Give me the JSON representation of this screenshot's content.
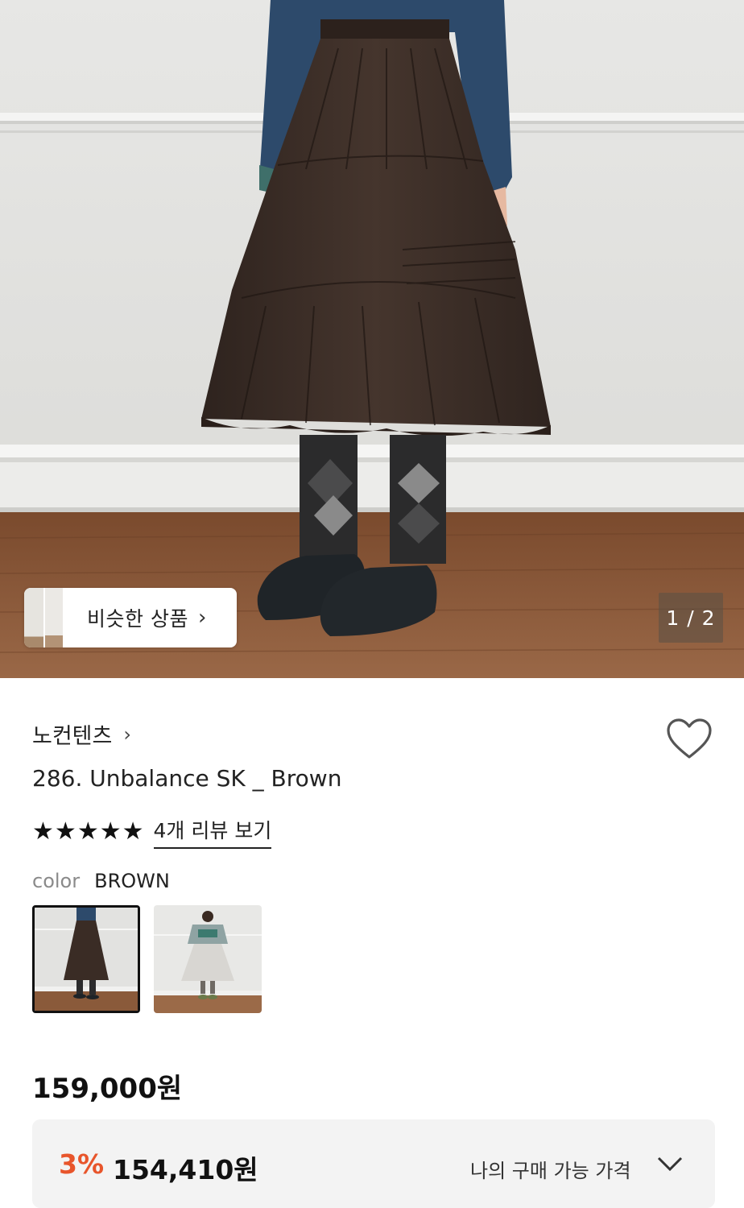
{
  "hero": {
    "similar_button_label": "비슷한 상품",
    "similar_button_icon": "chevron-right-icon",
    "pager": "1 / 2"
  },
  "product": {
    "brand": "노컨텐츠",
    "brand_icon": "chevron-right-icon",
    "title": "286. Unbalance SK _ Brown",
    "rating_stars": 5,
    "review_link": "4개 리뷰 보기",
    "color_label": "color",
    "color_value": "BROWN",
    "price": "159,000원",
    "discount_rate": "3%",
    "discount_price": "154,410원",
    "my_price_label": "나의 구매 가능 가격",
    "wishlist_icon": "heart-outline-icon",
    "accent_color": "#e8552b"
  }
}
